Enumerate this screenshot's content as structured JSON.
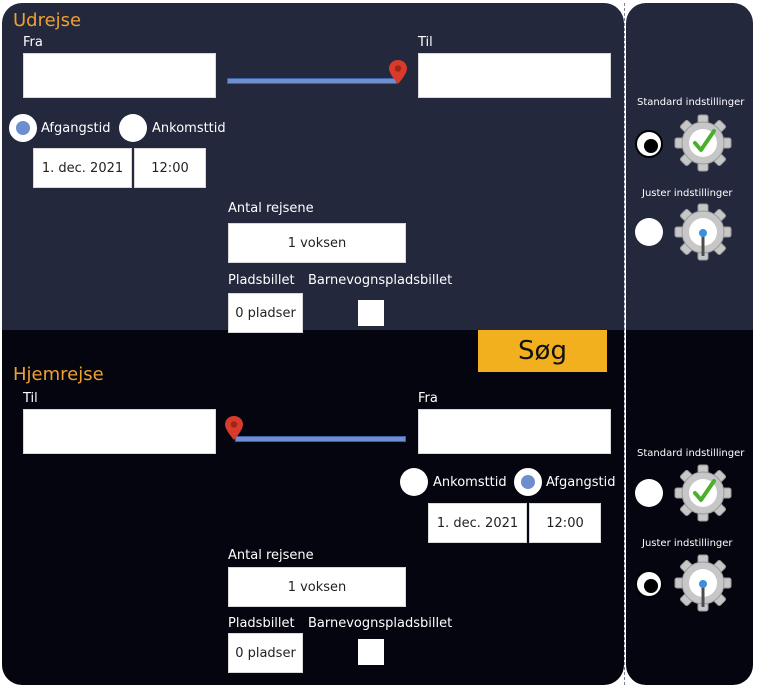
{
  "outbound": {
    "title": "Udrejse",
    "from_label": "Fra",
    "to_label": "Til",
    "from_value": "",
    "to_value": "",
    "departure_label": "Afgangstid",
    "arrival_label": "Ankomsttid",
    "selected_time_mode": "Afgangstid",
    "date": "1. dec. 2021",
    "time": "12:00",
    "travelers_label": "Antal rejsene",
    "travelers_value": "1 voksen",
    "seat_label": "Pladsbillet",
    "seat_value": "0 pladser",
    "stroller_label": "Barnevognspladsbillet"
  },
  "return": {
    "title": "Hjemrejse",
    "to_label": "Til",
    "from_label": "Fra",
    "to_value": "",
    "from_value": "",
    "arrival_label": "Ankomsttid",
    "departure_label": "Afgangstid",
    "selected_time_mode": "Afgangstid",
    "date": "1. dec. 2021",
    "time": "12:00",
    "travelers_label": "Antal rejsene",
    "travelers_value": "1 voksen",
    "seat_label": "Pladsbillet",
    "seat_value": "0 pladser",
    "stroller_label": "Barnevognspladsbillet"
  },
  "search_button": "Søg",
  "settings_outbound": {
    "standard_label": "Standard indstillinger",
    "custom_label": "Juster indstillinger",
    "selected": "Standard indstillinger"
  },
  "settings_return": {
    "standard_label": "Standard indstillinger",
    "custom_label": "Juster indstillinger",
    "selected": "Juster indstillinger"
  },
  "icons": {
    "map_pin": "map-pin-icon",
    "gear_check": "gear-check-icon",
    "gear_adjust": "gear-adjust-icon"
  },
  "colors": {
    "outbound_bg": "#23283d",
    "return_bg": "#05050f",
    "title": "#f0a030",
    "search_button": "#f2b01e",
    "route_line": "#6f8fce",
    "pin": "#d83b2b",
    "check": "#4caf2a"
  }
}
